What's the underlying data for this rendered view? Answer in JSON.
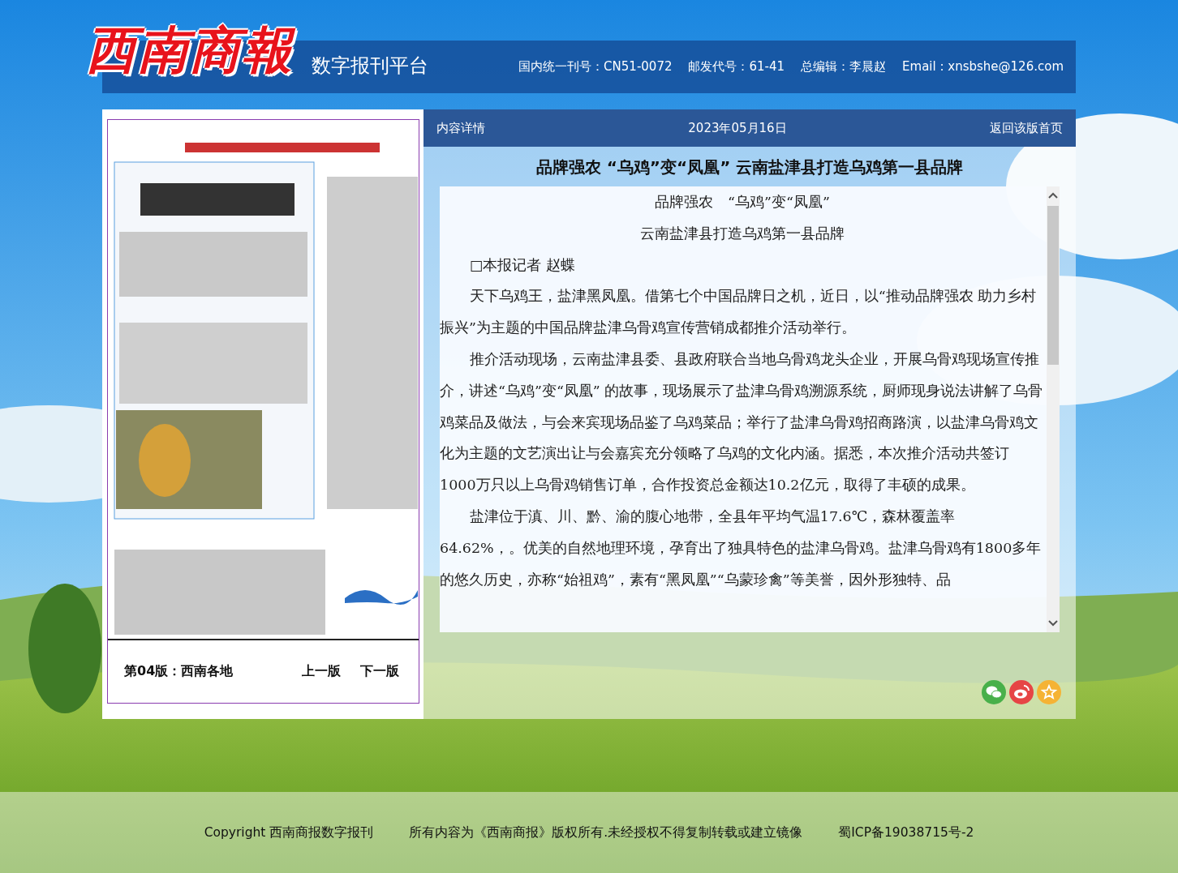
{
  "logo": {
    "text": "西南商報"
  },
  "header": {
    "platform": "数字报刊平台",
    "info": [
      "国内统一刊号：CN51-0072",
      "邮发代号：61-41",
      "总编辑：李晨赵",
      "Email : xnsbshe@126.com"
    ]
  },
  "edition": {
    "label": "第04版：西南各地",
    "prev": "上一版",
    "next": "下一版"
  },
  "article": {
    "section": "内容详情",
    "date": "2023年05月16日",
    "back": "返回该版首页",
    "title": "品牌强农 “乌鸡”变“凤凰” 云南盐津县打造乌鸡第一县品牌",
    "paragraphs": [
      {
        "kind": "center",
        "text": "品牌强农　“乌鸡”变“凤凰”"
      },
      {
        "kind": "center",
        "text": "云南盐津县打造乌鸡第一县品牌"
      },
      {
        "kind": "indent",
        "text": "□本报记者  赵蝶"
      },
      {
        "kind": "indent",
        "text": "天下乌鸡王，盐津黑凤凰。借第七个中国品牌日之机，近日，以“推动品牌强农 助力乡村振兴”为主题的中国品牌盐津乌骨鸡宣传营销成都推介活动举行。"
      },
      {
        "kind": "indent",
        "text": "推介活动现场，云南盐津县委、县政府联合当地乌骨鸡龙头企业，开展乌骨鸡现场宣传推介，讲述“乌鸡”变“凤凰” 的故事，现场展示了盐津乌骨鸡溯源系统，厨师现身说法讲解了乌骨鸡菜品及做法，与会来宾现场品鉴了乌鸡菜品；举行了盐津乌骨鸡招商路演，以盐津乌骨鸡文化为主题的文艺演出让与会嘉宾充分领略了乌鸡的文化内涵。据悉，本次推介活动共签订1000万只以上乌骨鸡销售订单，合作投资总金额达10.2亿元，取得了丰硕的成果。"
      },
      {
        "kind": "indent",
        "text": "盐津位于滇、川、黔、渝的腹心地带，全县年平均气温17.6℃，森林覆盖率"
      },
      {
        "kind": "plain",
        "text": "64.62%，。优美的自然地理环境，孕育出了独具特色的盐津乌骨鸡。盐津乌骨鸡有1800多年的悠久历史，亦称“始祖鸡”，素有“黑凤凰”“乌蒙珍禽”等美誉，因外形独特、品"
      }
    ]
  },
  "footer": [
    "Copyright 西南商报数字报刊",
    "所有内容为《西南商报》版权所有.未经授权不得复制转载或建立镜像",
    "蜀ICP备19038715号-2"
  ]
}
